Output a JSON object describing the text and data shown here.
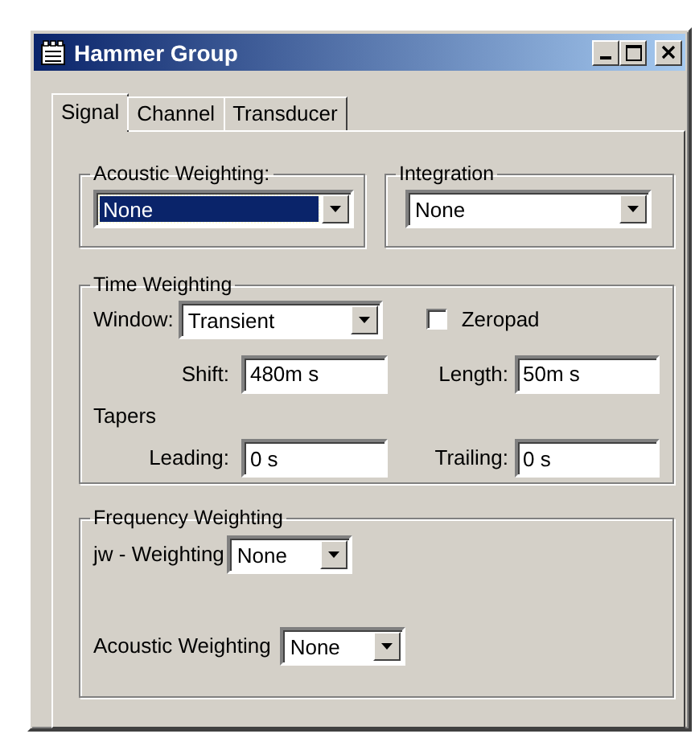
{
  "window": {
    "title": "Hammer Group"
  },
  "tabs": [
    {
      "label": "Signal",
      "selected": true
    },
    {
      "label": "Channel",
      "selected": false
    },
    {
      "label": "Transducer",
      "selected": false
    }
  ],
  "acoustic_weighting": {
    "label": "Acoustic Weighting:",
    "value": "None",
    "focused": true
  },
  "integration": {
    "label": "Integration",
    "value": "None",
    "focused": false
  },
  "time_weighting": {
    "label": "Time Weighting",
    "window": {
      "label": "Window:",
      "value": "Transient"
    },
    "zeropad": {
      "label": "Zeropad",
      "checked": false
    },
    "shift": {
      "label": "Shift:",
      "value": "480m s"
    },
    "length": {
      "label": "Length:",
      "value": "50m s"
    },
    "tapers_label": "Tapers",
    "leading": {
      "label": "Leading:",
      "value": "0 s"
    },
    "trailing": {
      "label": "Trailing:",
      "value": "0 s"
    }
  },
  "frequency_weighting": {
    "label": "Frequency Weighting",
    "jw_weighting": {
      "label": "jw - Weighting",
      "value": "None"
    },
    "acoustic_weighting": {
      "label": "Acoustic Weighting",
      "value": "None"
    }
  }
}
